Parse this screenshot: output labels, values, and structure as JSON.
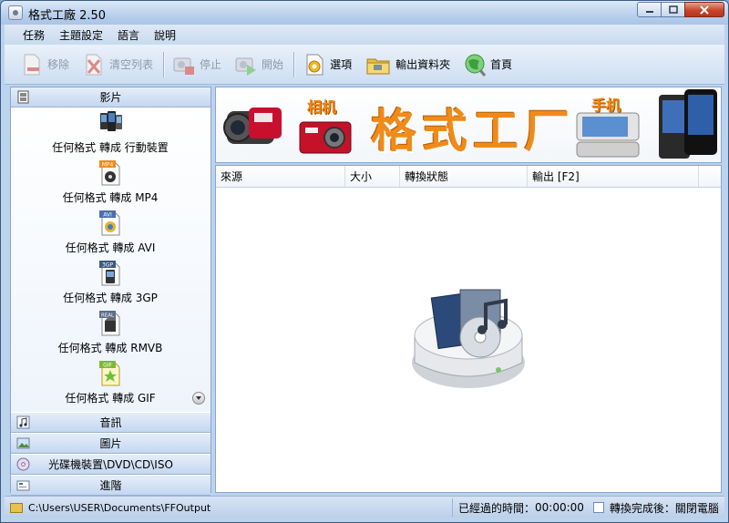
{
  "window": {
    "title": "格式工廠 2.50",
    "controls": [
      "minimize",
      "maximize",
      "close"
    ]
  },
  "menu": [
    "任務",
    "主題設定",
    "語言",
    "說明"
  ],
  "toolbar": [
    {
      "label": "移除",
      "icon": "remove-icon",
      "enabled": false
    },
    {
      "label": "清空列表",
      "icon": "clear-list-icon",
      "enabled": false
    },
    {
      "label": "停止",
      "icon": "stop-icon",
      "enabled": false
    },
    {
      "label": "開始",
      "icon": "start-icon",
      "enabled": false
    },
    {
      "label": "選項",
      "icon": "options-icon",
      "enabled": true
    },
    {
      "label": "輸出資料夾",
      "icon": "output-folder-icon",
      "enabled": true
    },
    {
      "label": "首頁",
      "icon": "home-icon",
      "enabled": true
    }
  ],
  "sidebar": {
    "video_header": "影片",
    "video_items": [
      {
        "label": "任何格式 轉成 行動裝置",
        "badge": ""
      },
      {
        "label": "任何格式 轉成 MP4",
        "badge": "MP4"
      },
      {
        "label": "任何格式 轉成 AVI",
        "badge": "AVI"
      },
      {
        "label": "任何格式 轉成 3GP",
        "badge": "3GP"
      },
      {
        "label": "任何格式 轉成 RMVB",
        "badge": "REAL"
      },
      {
        "label": "任何格式 轉成 GIF",
        "badge": "GIF"
      }
    ],
    "audio_header": "音訊",
    "picture_header": "圖片",
    "disc_header": "光碟機裝置\\DVD\\CD\\ISO",
    "advanced_header": "進階"
  },
  "banner": {
    "main_text": "格式工厂",
    "camera_text": "相机",
    "phone_text": "手机"
  },
  "filelist": {
    "columns": [
      "來源",
      "大小",
      "轉換狀態",
      "輸出 [F2]"
    ]
  },
  "statusbar": {
    "output_path": "C:\\Users\\USER\\Documents\\FFOutput",
    "elapsed_label": "已經過的時間：",
    "elapsed_time": "00:00:00",
    "shutdown_label": "轉換完成後：關閉電腦"
  }
}
